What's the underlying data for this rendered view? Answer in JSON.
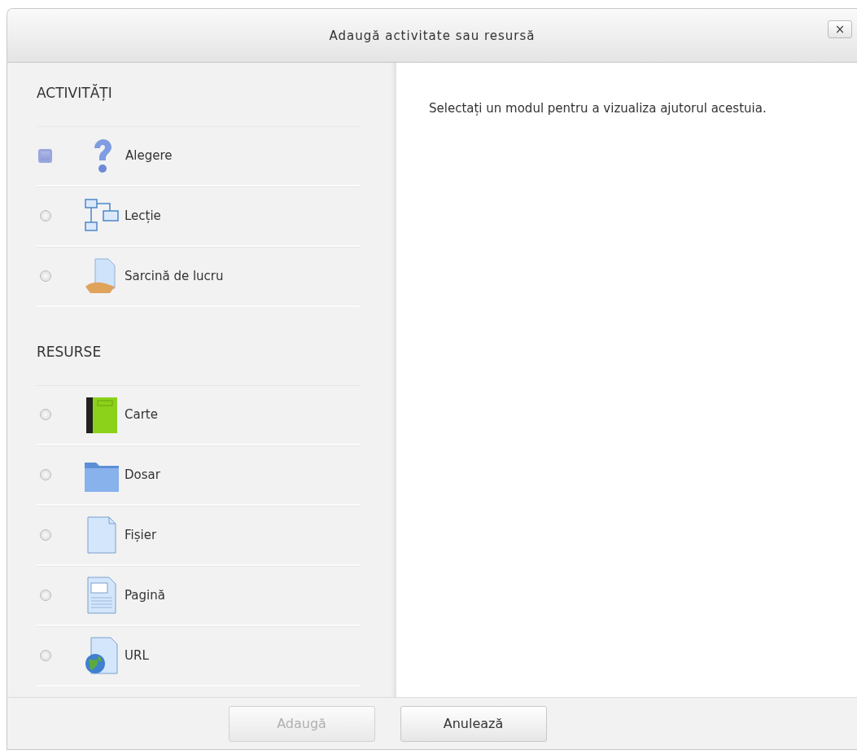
{
  "dialog": {
    "title": "Adaugă activitate sau resursă",
    "close": "×"
  },
  "sections": [
    {
      "heading": "ACTIVITĂȚI",
      "items": [
        {
          "kind": "choice",
          "label": "Alegere",
          "focused": true,
          "selected": false
        },
        {
          "kind": "lesson",
          "label": "Lecție",
          "focused": false,
          "selected": false
        },
        {
          "kind": "assignment",
          "label": "Sarcină de lucru",
          "focused": false,
          "selected": false
        }
      ]
    },
    {
      "heading": "RESURSE",
      "items": [
        {
          "kind": "book",
          "label": "Carte",
          "focused": false,
          "selected": false
        },
        {
          "kind": "folder",
          "label": "Dosar",
          "focused": false,
          "selected": false
        },
        {
          "kind": "file",
          "label": "Fișier",
          "focused": false,
          "selected": false
        },
        {
          "kind": "page",
          "label": "Pagină",
          "focused": false,
          "selected": false
        },
        {
          "kind": "url",
          "label": "URL",
          "focused": false,
          "selected": false
        }
      ]
    }
  ],
  "help": "Selectați un modul pentru a vizualiza ajutorul acestuia.",
  "buttons": [
    {
      "label": "Adaugă",
      "disabled": true
    },
    {
      "label": "Anulează",
      "disabled": false
    }
  ]
}
